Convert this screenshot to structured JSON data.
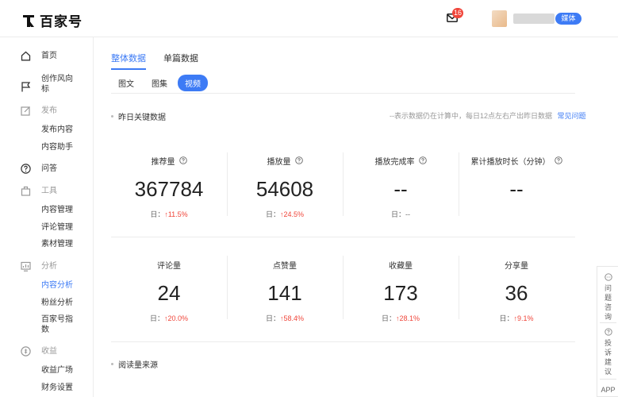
{
  "header": {
    "brand": "百家号",
    "mail_count": "16",
    "role_badge": "媒体"
  },
  "sidebar": {
    "items": [
      {
        "label": "首页",
        "icon": "home-icon",
        "type": "item"
      },
      {
        "label": "创作风向标",
        "icon": "flag-icon",
        "type": "item"
      },
      {
        "label": "发布",
        "icon": "edit-icon",
        "type": "group"
      },
      {
        "label": "发布内容",
        "type": "sub"
      },
      {
        "label": "内容助手",
        "type": "sub"
      },
      {
        "label": "问答",
        "icon": "question-icon",
        "type": "item"
      },
      {
        "label": "工具",
        "icon": "toolbox-icon",
        "type": "group"
      },
      {
        "label": "内容管理",
        "type": "sub"
      },
      {
        "label": "评论管理",
        "type": "sub"
      },
      {
        "label": "素材管理",
        "type": "sub"
      },
      {
        "label": "分析",
        "icon": "chart-icon",
        "type": "group"
      },
      {
        "label": "内容分析",
        "type": "sub",
        "active": true
      },
      {
        "label": "粉丝分析",
        "type": "sub"
      },
      {
        "label": "百家号指数",
        "type": "sub"
      },
      {
        "label": "收益",
        "icon": "coin-icon",
        "type": "group"
      },
      {
        "label": "收益广场",
        "type": "sub"
      },
      {
        "label": "财务设置",
        "type": "sub"
      }
    ]
  },
  "main": {
    "tabs": [
      {
        "label": "整体数据",
        "active": true
      },
      {
        "label": "单篇数据",
        "active": false
      }
    ],
    "subtabs": [
      {
        "label": "图文",
        "active": false
      },
      {
        "label": "图集",
        "active": false
      },
      {
        "label": "视频",
        "active": true
      }
    ],
    "yesterday_section": {
      "title": "昨日关键数据",
      "note": "--表示数据仍在计算中，每日12点左右产出昨日数据",
      "faq_link": "常见问题"
    },
    "metrics_row1": [
      {
        "label": "推荐量",
        "value": "367784",
        "day_prefix": "日：",
        "day_change": "↑11.5%",
        "has_help": true
      },
      {
        "label": "播放量",
        "value": "54608",
        "day_prefix": "日：",
        "day_change": "↑24.5%",
        "has_help": true
      },
      {
        "label": "播放完成率",
        "value": "--",
        "day_prefix": "日：",
        "day_change": "--",
        "has_help": true
      },
      {
        "label": "累计播放时长（分钟）",
        "value": "--",
        "day_prefix": "",
        "day_change": "",
        "has_help": true
      }
    ],
    "metrics_row2": [
      {
        "label": "评论量",
        "value": "24",
        "day_prefix": "日：",
        "day_change": "↑20.0%"
      },
      {
        "label": "点赞量",
        "value": "141",
        "day_prefix": "日：",
        "day_change": "↑58.4%"
      },
      {
        "label": "收藏量",
        "value": "173",
        "day_prefix": "日：",
        "day_change": "↑28.1%"
      },
      {
        "label": "分享量",
        "value": "36",
        "day_prefix": "日：",
        "day_change": "↑9.1%"
      }
    ],
    "source_section": {
      "title": "阅读量来源"
    }
  },
  "float_panel": {
    "feedback": "问题咨询",
    "complaint": "投诉建议",
    "app": "APP"
  },
  "colors": {
    "accent": "#3d7bf5",
    "up": "#f0453a"
  }
}
